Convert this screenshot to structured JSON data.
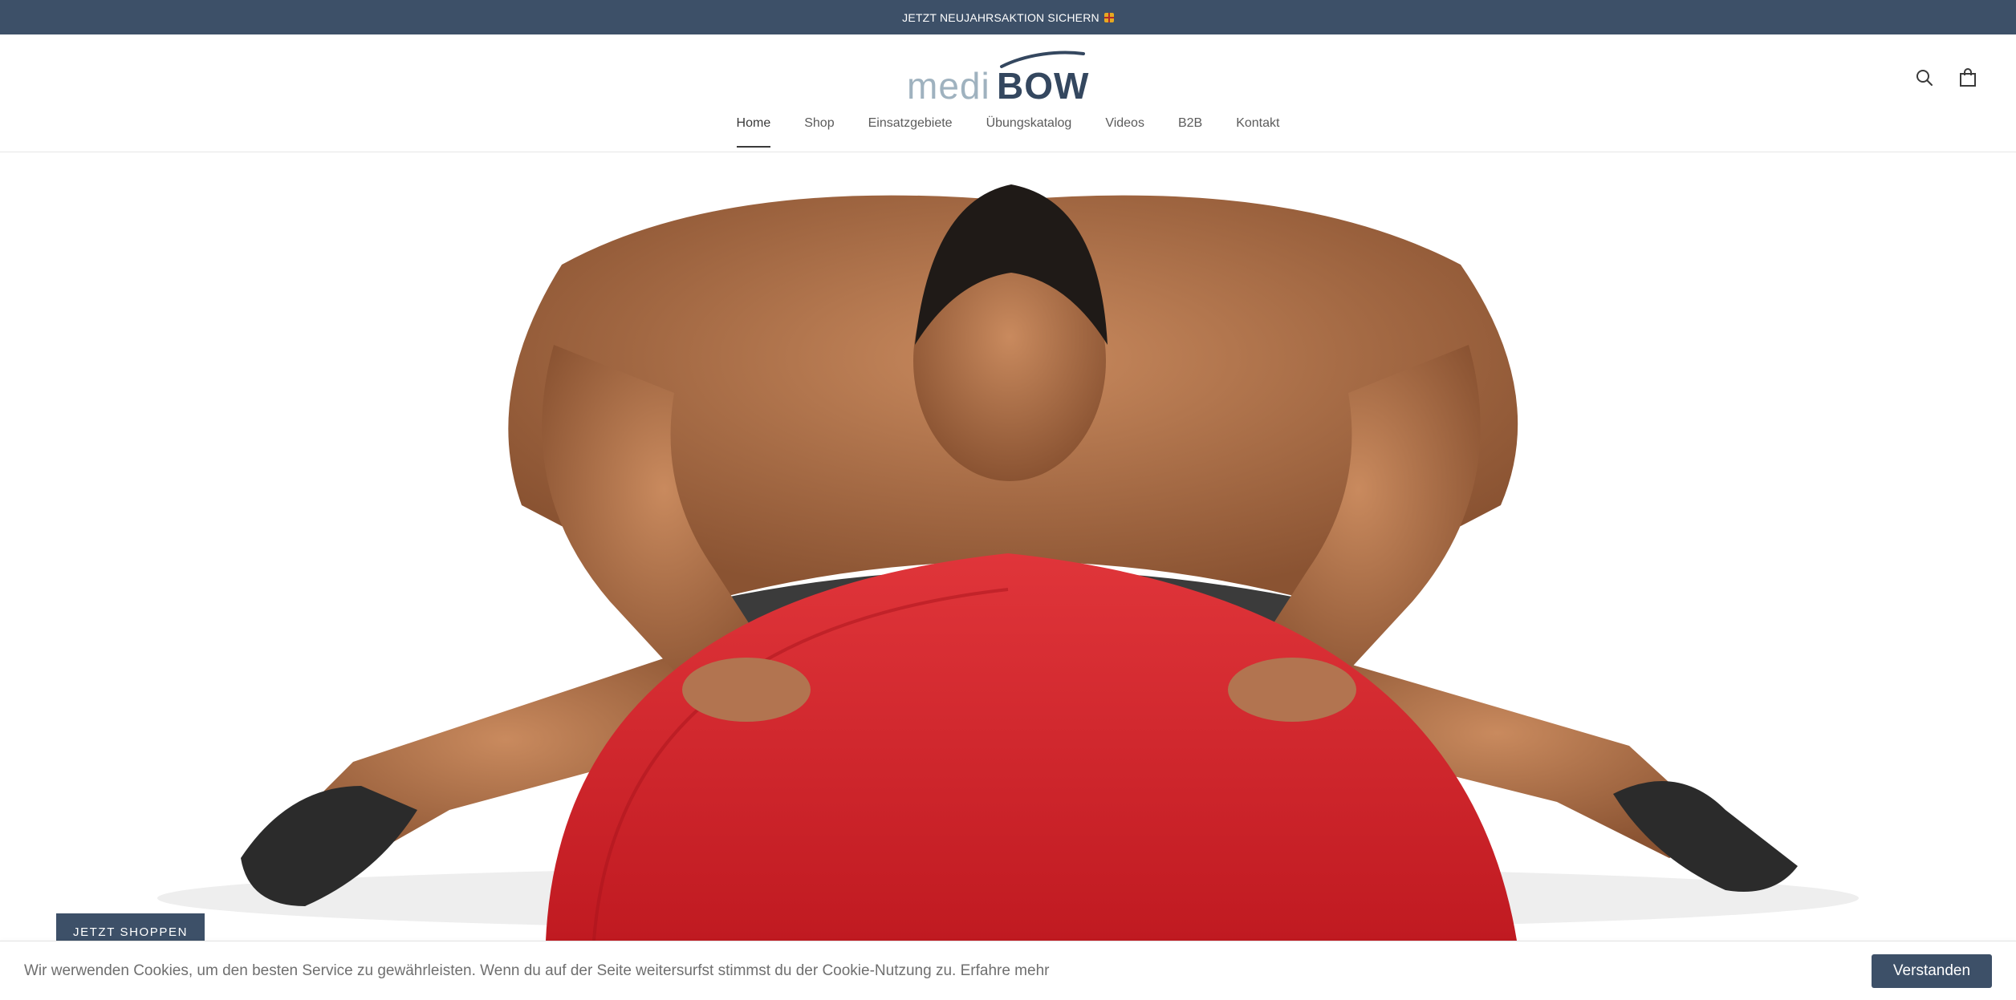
{
  "announcement": {
    "text": "JETZT NEUJAHRSAKTION SICHERN",
    "icon": "gift-icon"
  },
  "brand": {
    "logo_light": "medi",
    "logo_dark": "BOW",
    "color_light": "#9fb2bf",
    "color_dark": "#34475f"
  },
  "header": {
    "search_icon": "search-icon",
    "cart_icon": "shopping-bag-icon"
  },
  "nav": {
    "items": [
      {
        "label": "Home"
      },
      {
        "label": "Shop"
      },
      {
        "label": "Einsatzgebiete"
      },
      {
        "label": "Übungskatalog"
      },
      {
        "label": "Videos"
      },
      {
        "label": "B2B"
      },
      {
        "label": "Kontakt"
      }
    ],
    "active": "Home"
  },
  "hero": {
    "button_label": "JETZT SHOPPEN",
    "accent": "#3d5068"
  },
  "cookie": {
    "text": "Wir werwenden Cookies, um den besten Service zu gewährleisten. Wenn du auf der Seite weitersurfst stimmst du der Cookie-Nutzung zu.",
    "link": "Erfahre mehr",
    "button": "Verstanden"
  }
}
